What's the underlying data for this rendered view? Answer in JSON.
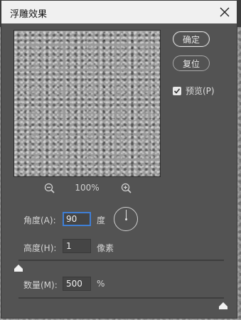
{
  "dialog": {
    "title": "浮雕效果",
    "buttons": {
      "ok": "确定",
      "reset": "复位"
    },
    "preview_checkbox": {
      "label": "预览(P)",
      "checked": true
    },
    "zoom": {
      "value": "100%",
      "zoom_out_icon": "zoom-out-icon",
      "zoom_in_icon": "zoom-in-icon"
    },
    "angle": {
      "label": "角度(A):",
      "value": "90",
      "unit": "度"
    },
    "height": {
      "label": "高度(H):",
      "value": "1",
      "unit": "像素"
    },
    "amount": {
      "label": "数量(M):",
      "value": "500",
      "unit": "%",
      "slider_min": 1,
      "slider_max": 500
    },
    "height_slider": {
      "min": 1,
      "max": 100,
      "value": 1
    }
  },
  "colors": {
    "dialog_bg": "#535353",
    "titlebar_bg": "#f0f0f0",
    "focus_accent": "#3f7fd6"
  }
}
